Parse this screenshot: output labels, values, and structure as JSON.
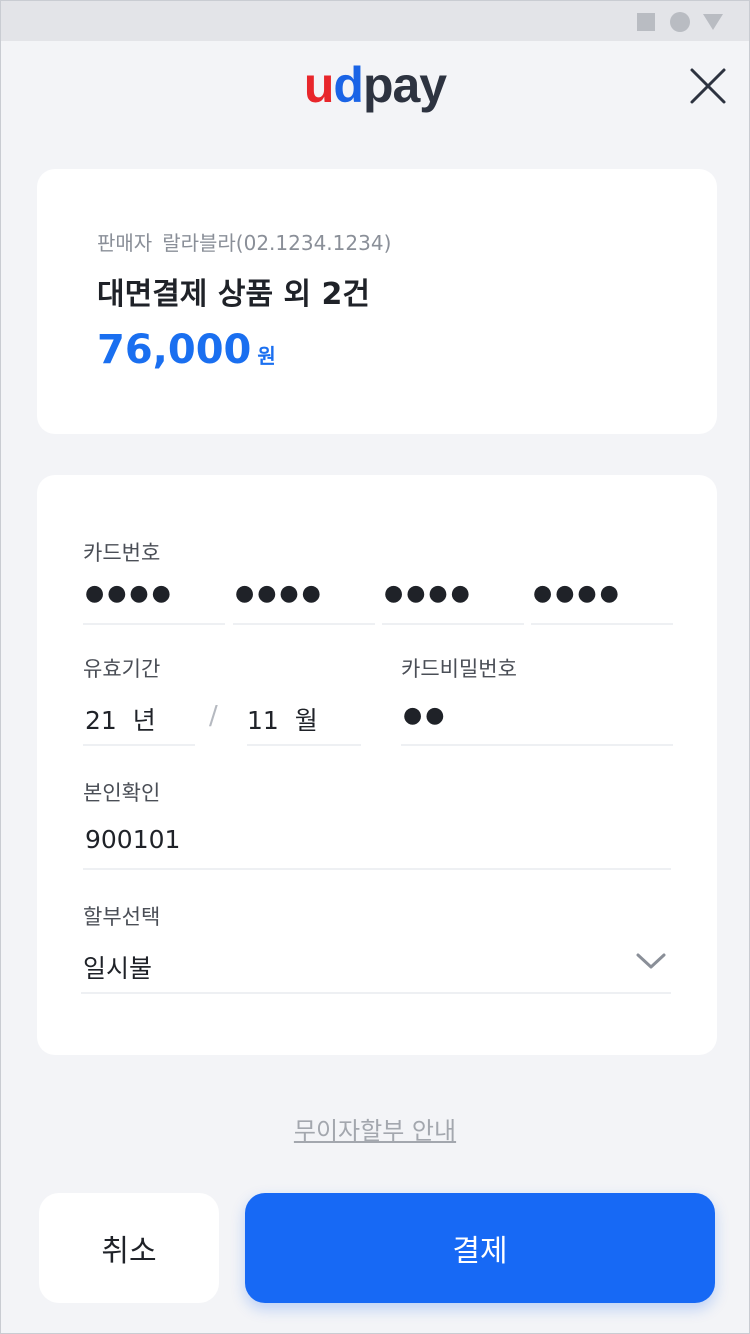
{
  "header": {
    "logo": {
      "u": "u",
      "d": "d",
      "pay": "pay"
    },
    "close_icon": "close-icon"
  },
  "order": {
    "seller_label": "판매자",
    "seller_value": "랄라블라(02.1234.1234)",
    "product": "대면결제 상품 외 2건",
    "amount": "76,000",
    "currency": "원"
  },
  "form": {
    "card_number": {
      "label": "카드번호",
      "groups": [
        "●●●●",
        "●●●●",
        "●●●●",
        "●●●●"
      ]
    },
    "expiry": {
      "label": "유효기간",
      "year": "21",
      "year_unit": "년",
      "separator": "/",
      "month": "11",
      "month_unit": "월"
    },
    "card_password": {
      "label": "카드비밀번호",
      "value": "●●"
    },
    "identity": {
      "label": "본인확인",
      "value": "900101"
    },
    "installment": {
      "label": "할부선택",
      "selected": "일시불",
      "icon": "chevron-down-icon"
    }
  },
  "links": {
    "interest_free_info": "무이자할부 안내"
  },
  "actions": {
    "cancel": "취소",
    "pay": "결제"
  },
  "colors": {
    "accent": "#1769f5",
    "price": "#1a6ff0",
    "logo_u": "#e8262b",
    "logo_d": "#1a64e6",
    "logo_pay": "#2d3340",
    "background": "#f3f4f7"
  }
}
